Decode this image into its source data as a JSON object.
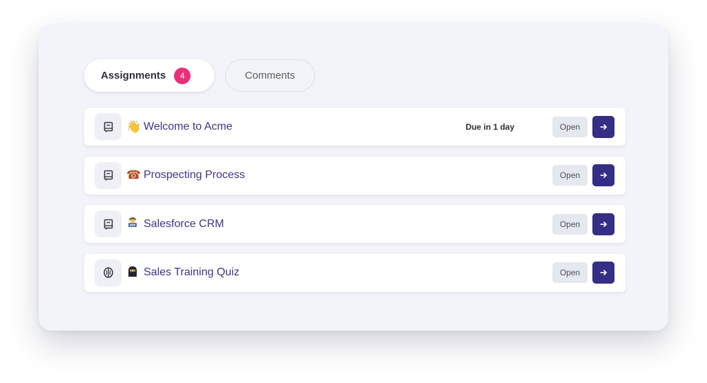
{
  "tabs": [
    {
      "label": "Assignments",
      "badge": "4",
      "active": true
    },
    {
      "label": "Comments",
      "active": false
    }
  ],
  "assignments": [
    {
      "icon": "book-icon",
      "emoji": "👋",
      "emoji_name": "waving-hand-emoji",
      "title": "Welcome to Acme",
      "due": "Due in 1 day",
      "open_label": "Open"
    },
    {
      "icon": "book-icon",
      "emoji": "☎",
      "emoji_name": "telephone-emoji",
      "title": "Prospecting Process",
      "due": "",
      "open_label": "Open"
    },
    {
      "icon": "book-icon",
      "emoji": "🧑‍💻",
      "emoji_name": "technologist-emoji",
      "title": "Salesforce CRM",
      "due": "",
      "open_label": "Open"
    },
    {
      "icon": "brain-icon",
      "emoji": "🥷",
      "emoji_name": "ninja-emoji",
      "title": "Sales Training Quiz",
      "due": "",
      "open_label": "Open"
    }
  ],
  "colors": {
    "accent": "#352e84",
    "badge": "#ec2f79",
    "title_text": "#3b3683",
    "panel_bg": "#f3f4f9"
  }
}
